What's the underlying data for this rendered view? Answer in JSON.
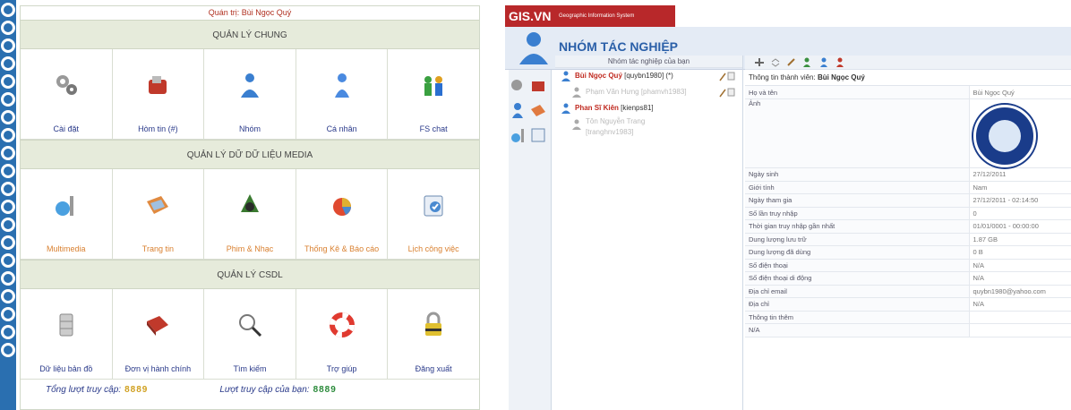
{
  "left": {
    "greeting": "Quán trị: Bùi Ngọc Quý",
    "sections": [
      {
        "title": "QUẢN LÝ CHUNG",
        "items": [
          {
            "label": "Cài đặt",
            "icon": "gears-icon",
            "orange": false
          },
          {
            "label": "Hòm tin (#)",
            "icon": "mailbox-icon",
            "orange": false
          },
          {
            "label": "Nhóm",
            "icon": "user-group-icon",
            "orange": false
          },
          {
            "label": "Cá nhân",
            "icon": "user-icon",
            "orange": false
          },
          {
            "label": "FS chat",
            "icon": "people-chat-icon",
            "orange": false
          }
        ]
      },
      {
        "title": "QUẢN LÝ DỮ DỮ LIỆU MEDIA",
        "items": [
          {
            "label": "Multimedia",
            "icon": "multimedia-chart-icon",
            "orange": true
          },
          {
            "label": "Trang tin",
            "icon": "news-page-icon",
            "orange": true
          },
          {
            "label": "Phim & Nhạc",
            "icon": "film-music-icon",
            "orange": true
          },
          {
            "label": "Thống Kê & Báo cáo",
            "icon": "pie-report-icon",
            "orange": true
          },
          {
            "label": "Lịch công việc",
            "icon": "calendar-icon",
            "orange": true
          }
        ]
      },
      {
        "title": "QUẢN LÝ CSDL",
        "items": [
          {
            "label": "Dữ liệu bản đồ",
            "icon": "database-icon",
            "orange": false
          },
          {
            "label": "Đơn vị hành chính",
            "icon": "book-icon",
            "orange": false
          },
          {
            "label": "Tìm kiếm",
            "icon": "magnifier-icon",
            "orange": false
          },
          {
            "label": "Trợ giúp",
            "icon": "lifebuoy-icon",
            "orange": false
          },
          {
            "label": "Đăng xuất",
            "icon": "padlock-icon",
            "orange": false
          }
        ]
      }
    ],
    "footer": {
      "total_label": "Tổng lượt truy cập:",
      "total_value": "8889",
      "yours_label": "Lượt truy cập của bạn:",
      "yours_value": "8889"
    }
  },
  "right": {
    "brand": "GIS.VN",
    "brand_sub": "Geographic Information System",
    "page_title": "NHÓM TÁC NGHIỆP",
    "tree_header": "Nhóm tác nghiệp của bạn",
    "tree": [
      {
        "name": "Bùi Ngọc Quý",
        "id": "[quybn1980] (*)",
        "level": 0
      },
      {
        "name": "",
        "id": "Phạm Văn Hưng [phamvh1983]",
        "level": 1
      },
      {
        "name": "Phan Sĩ Kiên",
        "id": "[kienps81]",
        "level": 0
      },
      {
        "name": "",
        "id": "Tôn Nguyễn Trang [tranghnv1983]",
        "level": 1
      }
    ],
    "info_header_label": "Thông tin thành viên:",
    "info_header_name": "Bùi Ngọc Quý",
    "fields": [
      {
        "k": "Họ và tên",
        "v": "Bùi Ngọc Quý"
      },
      {
        "k": "Ảnh",
        "v": ""
      },
      {
        "k": "Ngày sinh",
        "v": "27/12/2011"
      },
      {
        "k": "Giới tính",
        "v": "Nam"
      },
      {
        "k": "Ngày tham gia",
        "v": "27/12/2011 - 02:14:50"
      },
      {
        "k": "Số lần truy nhập",
        "v": "0"
      },
      {
        "k": "Thời gian truy nhập gần nhất",
        "v": "01/01/0001 - 00:00:00"
      },
      {
        "k": "Dung lượng lưu trữ",
        "v": "1.87 GB"
      },
      {
        "k": "Dung lượng đã dùng",
        "v": "0 B"
      },
      {
        "k": "Số điện thoại",
        "v": "N/A"
      },
      {
        "k": "Số điện thoại di động",
        "v": "N/A"
      },
      {
        "k": "Địa chỉ email",
        "v": "quybn1980@yahoo.com"
      },
      {
        "k": "Địa chỉ",
        "v": "N/A"
      },
      {
        "k": "Thông tin thêm",
        "v": ""
      },
      {
        "k": "N/A",
        "v": ""
      }
    ],
    "colors": {
      "brand_red": "#b8282a",
      "title_blue": "#2a5fa8",
      "link_blue": "#2a3a8a",
      "media_orange": "#d98030"
    }
  }
}
